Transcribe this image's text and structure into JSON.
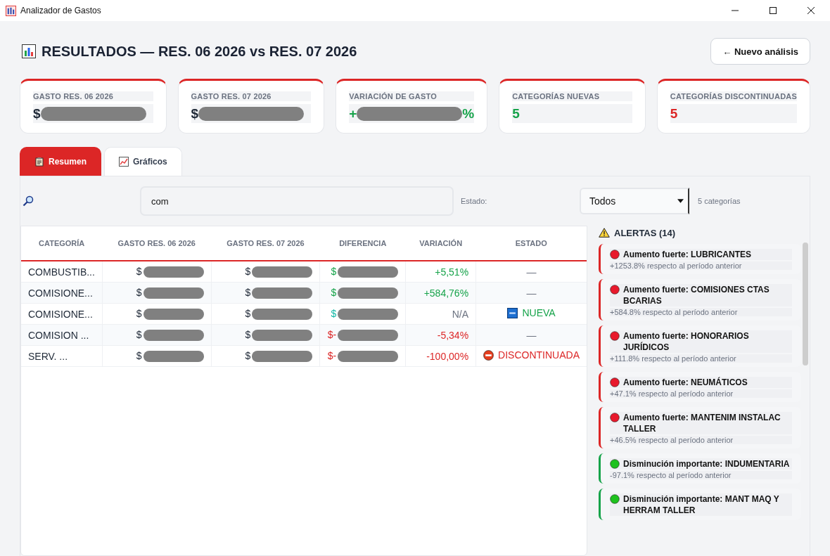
{
  "window": {
    "title": "Analizador de Gastos"
  },
  "header": {
    "title": "RESULTADOS — RES. 06 2026 vs RES. 07 2026",
    "button": "← Nuevo análisis"
  },
  "cards": [
    {
      "label": "GASTO RES. 06 2026",
      "value": {
        "prefix": "$",
        "redacted": true,
        "color": "#1f2937"
      }
    },
    {
      "label": "GASTO RES. 07 2026",
      "value": {
        "prefix": "$",
        "redacted": true,
        "color": "#1f2937"
      }
    },
    {
      "label": "VARIACIÓN DE GASTO",
      "value": {
        "prefix": "+",
        "redacted": true,
        "suffix": "%",
        "color": "#16a34a"
      }
    },
    {
      "label": "CATEGORÍAS NUEVAS",
      "value": {
        "prefix": "5",
        "color": "#16a34a"
      }
    },
    {
      "label": "CATEGORÍAS DISCONTINUADAS",
      "value": {
        "prefix": "5",
        "color": "#dc2626"
      }
    }
  ],
  "tabs": [
    {
      "label": "Resumen",
      "selected": true,
      "kind": "clipboard"
    },
    {
      "label": "Gráficos",
      "selected": false,
      "kind": "chart"
    }
  ],
  "filter": {
    "search_value": "com",
    "estado_label": "Estado:",
    "estado_value": "Todos",
    "count": "5 categorías"
  },
  "table": {
    "columns": [
      "CATEGORÍA",
      "GASTO RES. 06 2026",
      "GASTO RES. 07 2026",
      "DIFERENCIA",
      "VARIACIÓN",
      "ESTADO"
    ],
    "rows": [
      {
        "category": "COMBUSTIB...",
        "gasto_a": "$",
        "gasto_b": "$",
        "diff": {
          "text": "$",
          "color": "#16a34a"
        },
        "variation": {
          "text": "+5,51%",
          "color": "#16a34a"
        },
        "estado": {
          "kind": "none",
          "text": "—"
        }
      },
      {
        "category": "COMISIONE...",
        "gasto_a": "$",
        "gasto_b": "$",
        "diff": {
          "text": "$",
          "color": "#16a34a"
        },
        "variation": {
          "text": "+584,76%",
          "color": "#16a34a"
        },
        "estado": {
          "kind": "none",
          "text": "—"
        }
      },
      {
        "category": "COMISIONE...",
        "gasto_a": "$",
        "gasto_b": "$",
        "diff": {
          "text": "$",
          "color": "#14b8a6"
        },
        "variation": {
          "text": "N/A",
          "color": "#6b7280"
        },
        "estado": {
          "kind": "new",
          "text": "NUEVA"
        }
      },
      {
        "category": "COMISION ...",
        "gasto_a": "$",
        "gasto_b": "$",
        "diff": {
          "text": "$-",
          "color": "#dc2626"
        },
        "variation": {
          "text": "-5,34%",
          "color": "#dc2626"
        },
        "estado": {
          "kind": "none",
          "text": "—"
        }
      },
      {
        "category": "SERV. ...",
        "gasto_a": "$",
        "gasto_b": "$",
        "diff": {
          "text": "$-",
          "color": "#dc2626"
        },
        "variation": {
          "text": "-100,00%",
          "color": "#dc2626"
        },
        "estado": {
          "kind": "discontinued",
          "text": "DISCONTINUADA"
        }
      }
    ]
  },
  "alerts": {
    "title": "ALERTAS (14)",
    "items": [
      {
        "kind": "increase",
        "title": "Aumento fuerte: LUBRICANTES",
        "detail": "+1253.8% respecto al período anterior"
      },
      {
        "kind": "increase",
        "title": "Aumento fuerte: COMISIONES CTAS BCARIAS",
        "detail": "+584.8% respecto al período anterior"
      },
      {
        "kind": "increase",
        "title": "Aumento fuerte: HONORARIOS JURÍDICOS",
        "detail": "+111.8% respecto al período anterior"
      },
      {
        "kind": "increase",
        "title": "Aumento fuerte: NEUMÁTICOS",
        "detail": "+47.1% respecto al período anterior"
      },
      {
        "kind": "increase",
        "title": "Aumento fuerte: MANTENIM INSTALAC TALLER",
        "detail": "+46.5% respecto al período anterior"
      },
      {
        "kind": "decrease",
        "title": "Disminución importante: INDUMENTARIA",
        "detail": "-97.1% respecto al período anterior"
      },
      {
        "kind": "decrease",
        "title": "Disminución importante: MANT MAQ Y HERRAM TALLER"
      }
    ]
  }
}
